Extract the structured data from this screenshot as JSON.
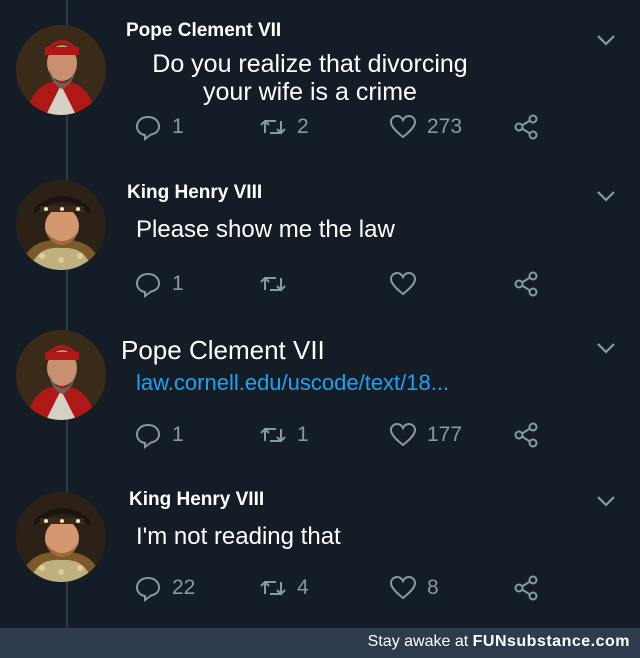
{
  "tweets": [
    {
      "author": "Pope Clement VII",
      "text_lines": [
        "Do you realize that divorcing",
        "your wife is a crime"
      ],
      "replies": "1",
      "retweets": "2",
      "likes": "273",
      "avatar_icon": "pope-avatar"
    },
    {
      "author": "King Henry VIII",
      "text": "Please show me the law",
      "replies": "1",
      "retweets": "",
      "likes": "",
      "avatar_icon": "king-avatar"
    },
    {
      "author": "Pope Clement VII",
      "text": "law.cornell.edu/uscode/text/18...",
      "replies": "1",
      "retweets": "1",
      "likes": "177",
      "avatar_icon": "pope-avatar"
    },
    {
      "author": "King Henry VIII",
      "text": "I'm not reading that",
      "replies": "22",
      "retweets": "4",
      "likes": "8",
      "avatar_icon": "king-avatar"
    }
  ],
  "footer": {
    "prefix": "Stay awake at",
    "brand": "FUNsubstance.com"
  },
  "colors": {
    "background": "#141d26",
    "link": "#1da1f2",
    "muted": "#8899a6",
    "footer_bg": "#2d3b4d"
  }
}
